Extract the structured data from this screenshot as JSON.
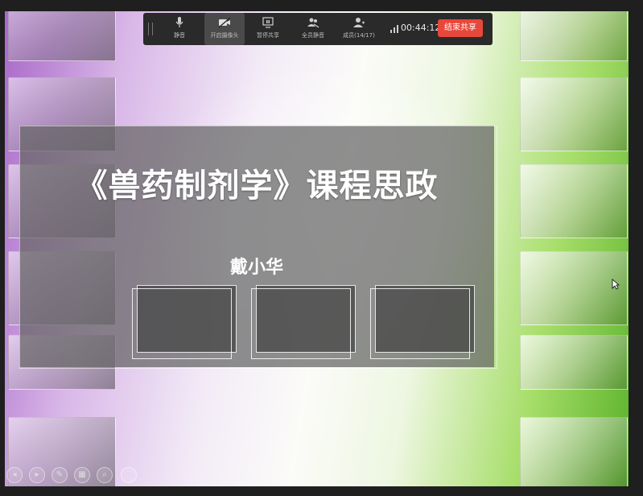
{
  "toolbar": {
    "items": [
      {
        "label": "静音",
        "icon": "microphone-icon"
      },
      {
        "label": "开启摄像头",
        "icon": "camera-icon"
      },
      {
        "label": "暂停共享",
        "icon": "screen-share-icon"
      },
      {
        "label": "全员静音",
        "icon": "mute-all-icon"
      },
      {
        "label": "成员(14/17)",
        "icon": "members-icon"
      }
    ],
    "timer": "00:44:12",
    "end_share_label": "结束共享"
  },
  "slide": {
    "title": "《兽药制剂学》课程思政",
    "author": "戴小华"
  },
  "presentation_controls": {
    "icons": [
      "prev-slide-icon",
      "next-slide-icon",
      "pen-icon",
      "slides-grid-icon",
      "zoom-icon",
      "more-icon"
    ]
  },
  "colors": {
    "end_button": "#e8473b",
    "toolbar_bg": "#2a2a2a"
  }
}
